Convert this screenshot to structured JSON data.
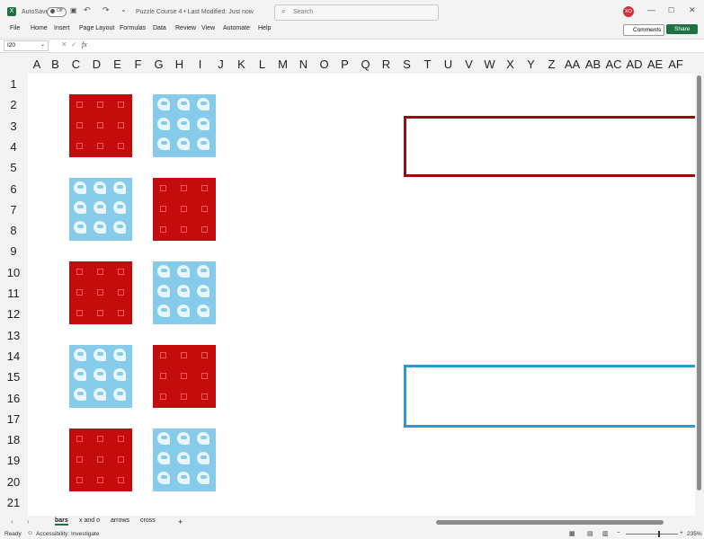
{
  "titlebar": {
    "autosave_label": "AutoSave",
    "autosave_state": "Off",
    "doc_title": "Puzzle Course 4",
    "modified": "Last Modified: Just now",
    "search_placeholder": "Search",
    "user_initials": "XO"
  },
  "ribbon": {
    "tabs": [
      "File",
      "Home",
      "Insert",
      "Page Layout",
      "Formulas",
      "Data",
      "Review",
      "View",
      "Automate",
      "Help"
    ],
    "comments_label": "Comments",
    "share_label": "Share"
  },
  "formula_bar": {
    "name_box": "I20",
    "fx": "fx",
    "value": ""
  },
  "grid": {
    "columns": [
      "A",
      "B",
      "C",
      "D",
      "E",
      "F",
      "G",
      "H",
      "I",
      "J",
      "K",
      "L",
      "M",
      "N",
      "O",
      "P",
      "Q",
      "R",
      "S",
      "T",
      "U",
      "V",
      "W",
      "X",
      "Y",
      "Z",
      "AA",
      "AB",
      "AC",
      "AD",
      "AE",
      "AF"
    ],
    "rows": [
      "1",
      "2",
      "3",
      "4",
      "5",
      "6",
      "7",
      "8",
      "9",
      "10",
      "11",
      "12",
      "13",
      "14",
      "15",
      "16",
      "17",
      "18",
      "19",
      "20",
      "21"
    ],
    "tiles_left": [
      "red",
      "blue",
      "red",
      "blue",
      "red"
    ],
    "tiles_right": [
      "blue",
      "red",
      "blue",
      "red",
      "blue"
    ],
    "colors": {
      "red_tile": "#c40c0c",
      "blue_tile": "#86cbe9",
      "red_box": "#9b0c0c",
      "blue_box": "#2a9bd3"
    }
  },
  "sheets": {
    "tabs": [
      "bars",
      "x and o",
      "arrows",
      "cross"
    ],
    "active": "bars",
    "add": "+"
  },
  "status": {
    "ready": "Ready",
    "accessibility": "Accessibility: Investigate",
    "zoom": "235%"
  }
}
